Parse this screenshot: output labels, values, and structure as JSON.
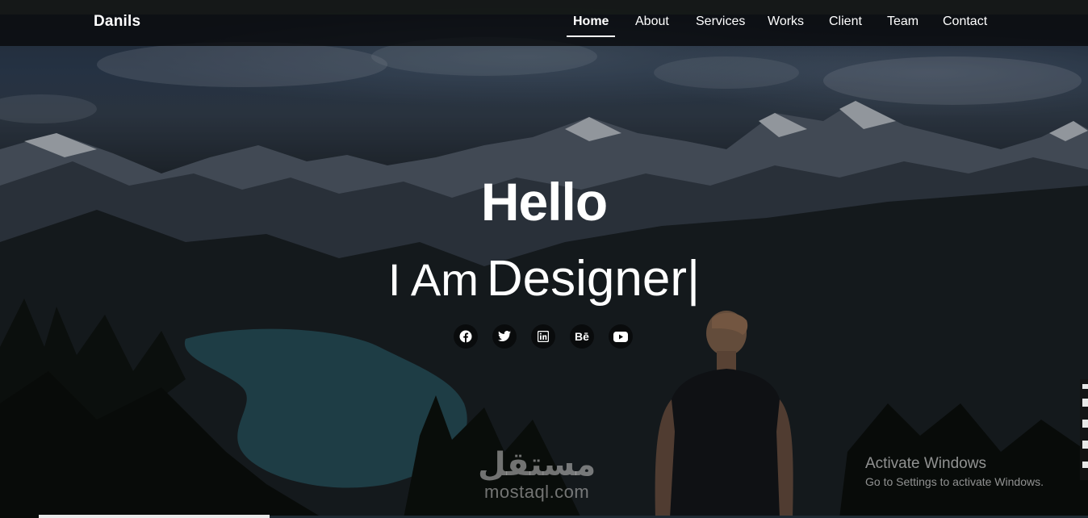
{
  "brand": "Danils",
  "nav": {
    "items": [
      {
        "label": "Home",
        "active": true
      },
      {
        "label": "About",
        "active": false
      },
      {
        "label": "Services",
        "active": false
      },
      {
        "label": "Works",
        "active": false
      },
      {
        "label": "Client",
        "active": false
      },
      {
        "label": "Team",
        "active": false
      },
      {
        "label": "Contact",
        "active": false
      }
    ]
  },
  "hero": {
    "heading": "Hello",
    "lead": "I Am",
    "role": "Designer",
    "caret": "|"
  },
  "socials": [
    {
      "name": "facebook-icon"
    },
    {
      "name": "twitter-icon"
    },
    {
      "name": "linkedin-icon"
    },
    {
      "name": "behance-icon",
      "glyph": "Bē"
    },
    {
      "name": "youtube-icon"
    }
  ],
  "watermark": {
    "arabic": "مستقل",
    "latin": "mostaql.com"
  },
  "windows_notice": {
    "title": "Activate Windows",
    "subtitle": "Go to Settings to activate Windows."
  }
}
